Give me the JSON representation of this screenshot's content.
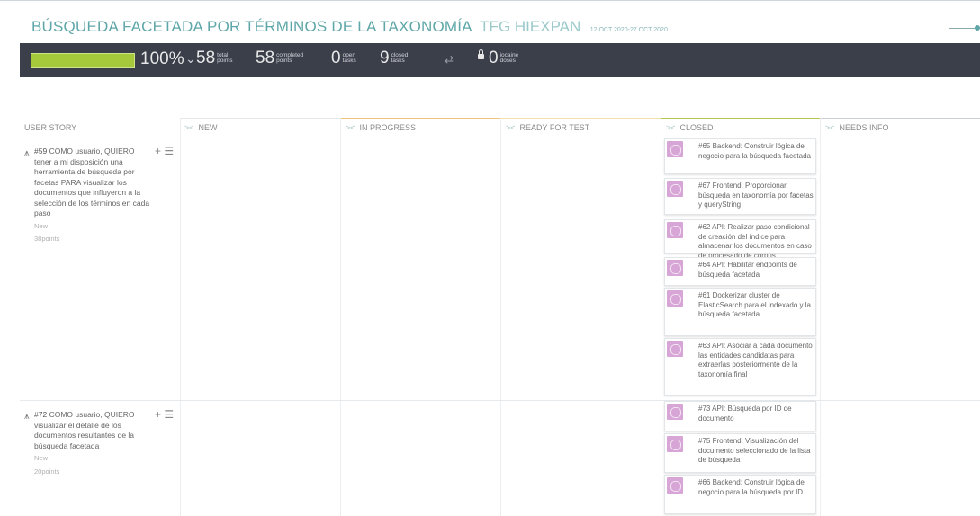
{
  "header": {
    "title": "BÚSQUEDA FACETADA POR TÉRMINOS DE LA TAXONOMÍA",
    "project": "TFG HIEXPAN",
    "dates": "12 OCT 2020-27 OCT 2020"
  },
  "stats": {
    "progress_percent": 100,
    "percent_label": "100%",
    "total_points": {
      "value": "58",
      "label": "total points"
    },
    "completed_points": {
      "value": "58",
      "label": "completed points"
    },
    "open_tasks": {
      "value": "0",
      "label": "open tasks"
    },
    "closed_tasks": {
      "value": "9",
      "label": "closed tasks"
    },
    "iocaine": {
      "value": "0",
      "label": "iocaine doses"
    }
  },
  "columns": {
    "user_story": "USER STORY",
    "new": "NEW",
    "in_progress": "IN PROGRESS",
    "ready_for_test": "READY FOR TEST",
    "closed": "CLOSED",
    "needs_info": "NEEDS INFO"
  },
  "colors": {
    "new": "#e4e7ea",
    "in_progress": "#f0c47b",
    "ready_for_test": "#f3e0a8",
    "closed": "#b6c64e",
    "needs_info": "#c9cfd4",
    "progress_bar": "#a5c93a",
    "statsbar_bg": "#3b3f4a",
    "title": "#5fa6a8"
  },
  "stories": [
    {
      "ref": "#59",
      "text": "COMO usuario, QUIERO tener a mi disposición una herramienta de búsqueda por facetas PARA visualizar los documentos que influyeron a la selección de los términos en cada paso",
      "status": "New",
      "points": "38points"
    },
    {
      "ref": "#72",
      "text": "COMO usuario, QUIERO visualizar el detalle de los documentos resultantes de la búsqueda facetada",
      "status": "New",
      "points": "20points"
    }
  ],
  "closed_tasks_story1": [
    "#65 Backend: Construir lógica de negocio para la búsqueda facetada",
    "#67 Frontend: Proporcionar búsqueda en taxonomía por facetas y queryString",
    "#62 API: Realizar paso condicional de creación del índice para almacenar los documentos en caso de procesado de corpus",
    "#64 API: Habilitar endpoints de búsqueda facetada",
    "#61 Dockerizar cluster de ElasticSearch para el indexado y la búsqueda facetada",
    "#63 API: Asociar a cada documento las entidades candidatas para extraerlas posteriormente de la taxonomía final"
  ],
  "closed_tasks_story2": [
    "#73 API: Búsqueda por ID de documento",
    "#75 Frontend: Visualización del documento seleccionado de la lista de búsqueda",
    "#66 Backend: Construir lógica de negocio para la búsqueda por ID"
  ],
  "icons": {
    "collapse": "chevron-collapse-icon",
    "add": "plus-icon",
    "list": "list-icon",
    "lock": "lock-icon",
    "swap": "swap-arrows-icon"
  }
}
